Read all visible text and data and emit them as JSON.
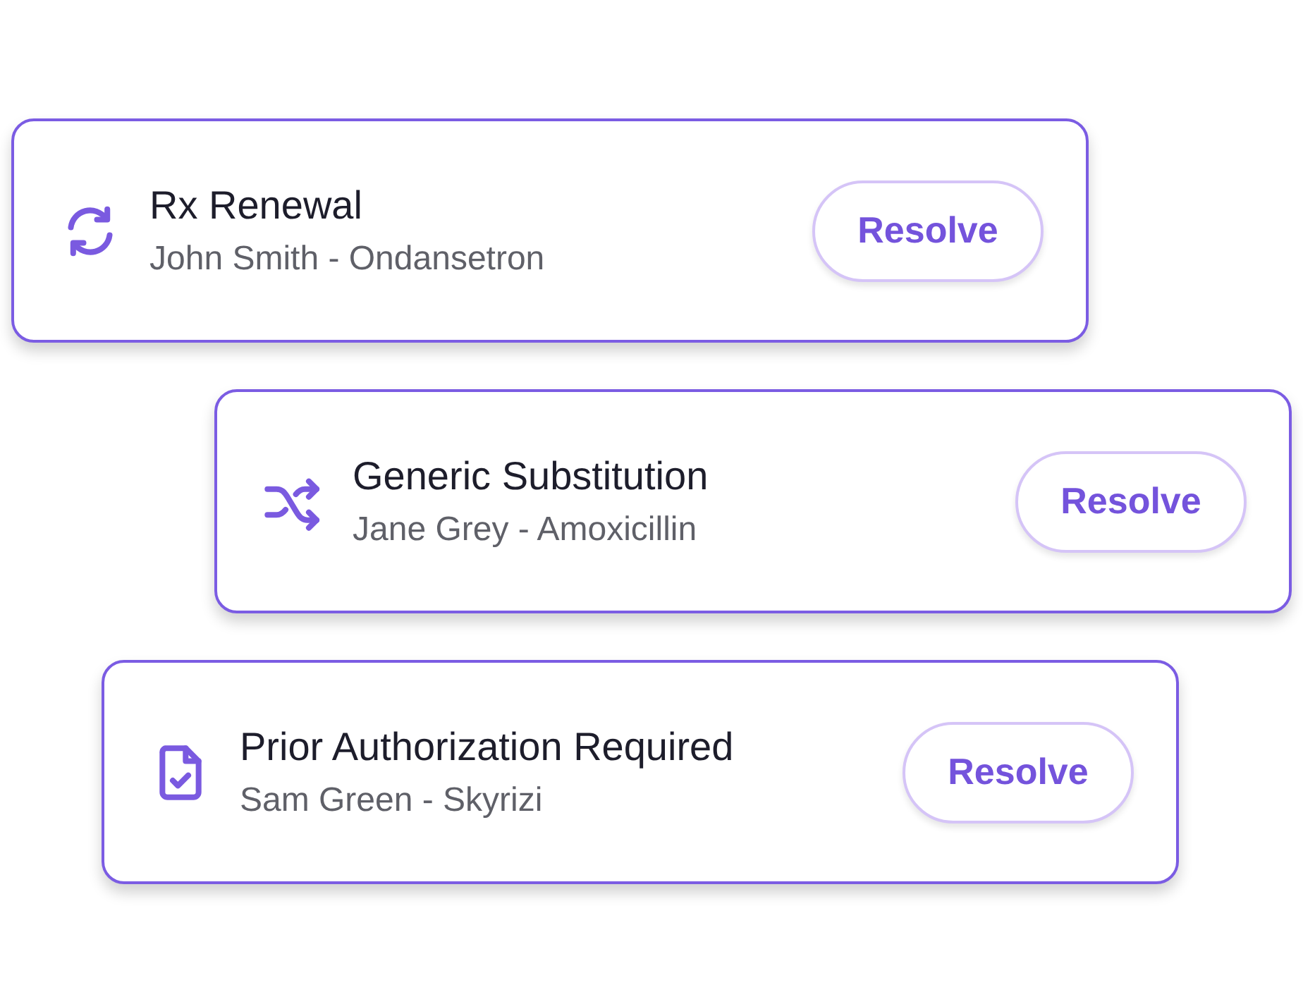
{
  "tasks": [
    {
      "kind": "renewal",
      "title": "Rx Renewal",
      "subtitle": "John Smith - Ondansetron",
      "action": "Resolve"
    },
    {
      "kind": "substitution",
      "title": "Generic Substitution",
      "subtitle": "Jane Grey - Amoxicillin",
      "action": "Resolve"
    },
    {
      "kind": "authorization",
      "title": "Prior Authorization Required",
      "subtitle": "Sam Green - Skyrizi",
      "action": "Resolve"
    }
  ]
}
